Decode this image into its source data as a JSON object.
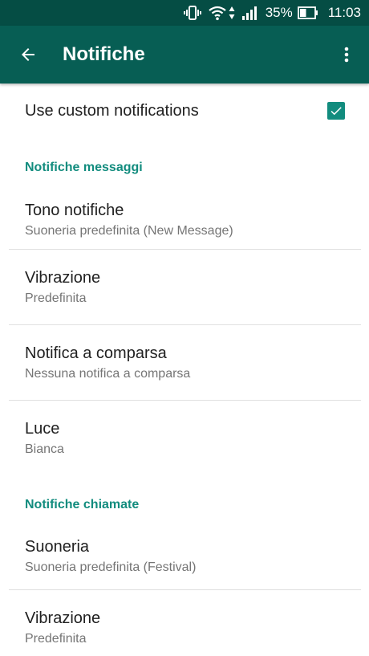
{
  "status_bar": {
    "battery_percent": "35%",
    "time": "11:03"
  },
  "app_bar": {
    "title": "Notifiche",
    "back_icon": "arrow-back-icon",
    "overflow_icon": "more-vert-icon"
  },
  "colors": {
    "status_bar": "#054d44",
    "app_bar": "#075e54",
    "accent": "#128c7e"
  },
  "custom_notifications": {
    "label": "Use custom notifications",
    "checked": true
  },
  "messages_section": {
    "header": "Notifiche messaggi",
    "items": [
      {
        "title": "Tono notifiche",
        "summary": "Suoneria predefinita (New Message)"
      },
      {
        "title": "Vibrazione",
        "summary": "Predefinita"
      },
      {
        "title": "Notifica a comparsa",
        "summary": "Nessuna notifica a comparsa"
      },
      {
        "title": "Luce",
        "summary": "Bianca"
      }
    ]
  },
  "calls_section": {
    "header": "Notifiche chiamate",
    "items": [
      {
        "title": "Suoneria",
        "summary": "Suoneria predefinita (Festival)"
      },
      {
        "title": "Vibrazione",
        "summary": "Predefinita"
      }
    ]
  }
}
